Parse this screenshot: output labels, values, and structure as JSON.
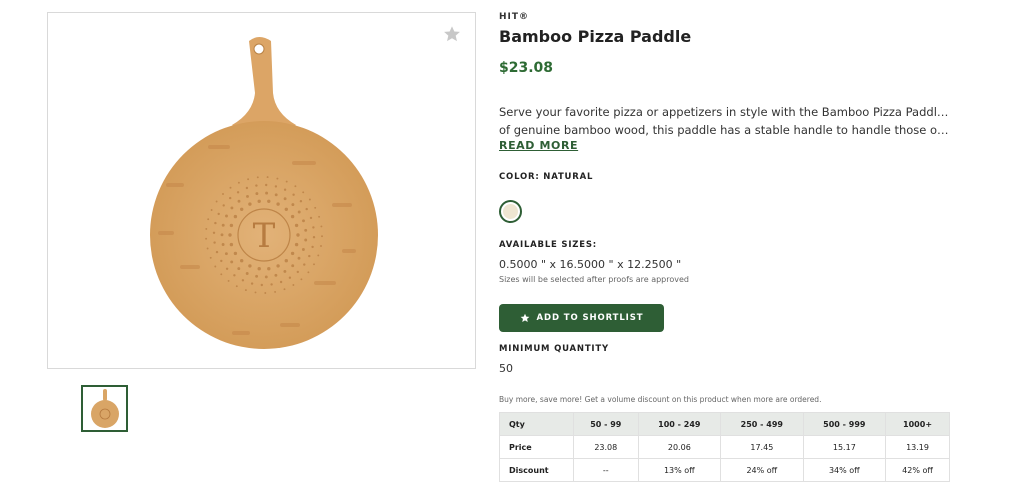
{
  "gallery": {
    "monogram": "T",
    "favorite_icon": "star-icon",
    "thumbnail_count": 1
  },
  "product": {
    "brand": "HIT®",
    "title": "Bamboo Pizza Paddle",
    "price": "$23.08",
    "description_line1": "Serve your favorite pizza or appetizers in style with the Bamboo Pizza Paddle. Made",
    "description_line2": "of genuine bamboo wood, this paddle has a stable handle to handle those overstuff...",
    "read_more": "READ MORE"
  },
  "color": {
    "label": "COLOR: NATURAL",
    "swatch_color": "#efe6d2"
  },
  "sizes": {
    "label": "AVAILABLE SIZES:",
    "value": "0.5000 \" x 16.5000 \" x 12.2500 \"",
    "note": "Sizes will be selected after proofs are approved"
  },
  "actions": {
    "shortlist_label": "ADD TO SHORTLIST",
    "shortlist_icon": "star-icon"
  },
  "minimum": {
    "label": "MINIMUM QUANTITY",
    "value": "50"
  },
  "volume": {
    "note": "Buy more, save more! Get a volume discount on this product when more are ordered.",
    "table": {
      "header": [
        "Qty",
        "50 - 99",
        "100 - 249",
        "250 - 499",
        "500 - 999",
        "1000+"
      ],
      "rows": [
        [
          "Price",
          "23.08",
          "20.06",
          "17.45",
          "15.17",
          "13.19"
        ],
        [
          "Discount",
          "--",
          "13% off",
          "24% off",
          "34% off",
          "42% off"
        ]
      ]
    }
  },
  "colors": {
    "accent_green": "#2e5e35",
    "price_green": "#2e6b34",
    "table_header_bg": "#e7eae7",
    "bamboo": "#d9a566"
  }
}
